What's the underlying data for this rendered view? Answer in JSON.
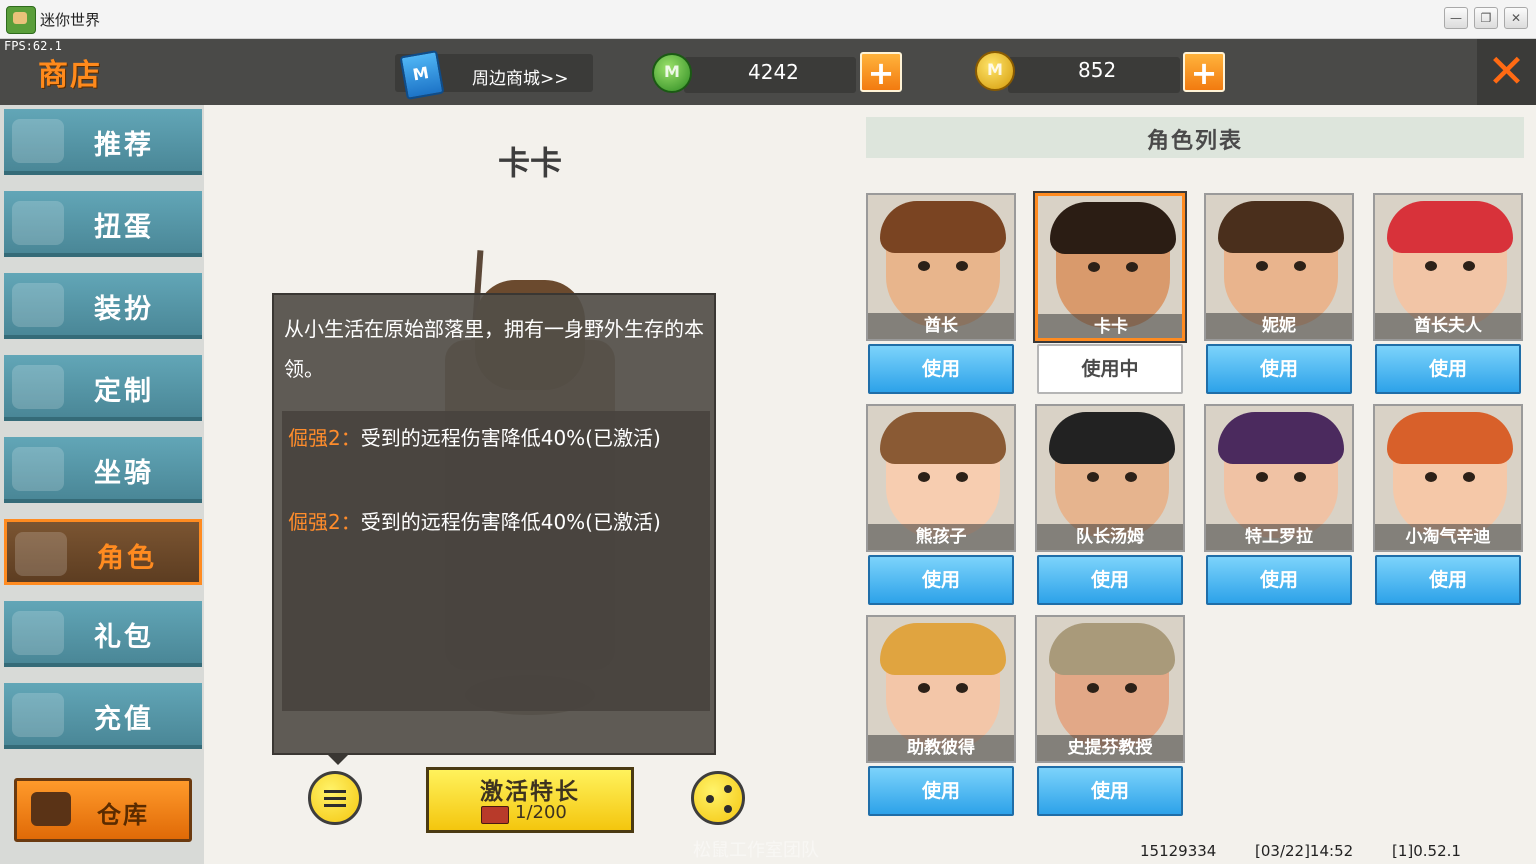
{
  "window": {
    "title": "迷你世界",
    "minimize": "—",
    "maximize": "❐",
    "close": "✕"
  },
  "topbar": {
    "fps": "FPS:62.1",
    "shop_title": "商店",
    "peripheral_link": "周边商城>>",
    "currency_m": "4242",
    "currency_coin": "852",
    "plus": "+",
    "close": "✕"
  },
  "sidebar": {
    "items": [
      {
        "label": "推荐",
        "icon": "thumbs-up-icon"
      },
      {
        "label": "扭蛋",
        "icon": "capsule-icon"
      },
      {
        "label": "装扮",
        "icon": "shirt-icon"
      },
      {
        "label": "定制",
        "icon": "pencil-icon"
      },
      {
        "label": "坐骑",
        "icon": "mount-icon"
      },
      {
        "label": "角色",
        "icon": "character-icon",
        "active": true
      },
      {
        "label": "礼包",
        "icon": "gift-icon"
      },
      {
        "label": "充值",
        "icon": "coins-icon"
      }
    ],
    "warehouse": "仓库"
  },
  "character": {
    "name": "卡卡",
    "description": "从小生活在原始部落里，拥有一身野外生存的本领。",
    "skills": [
      {
        "tag": "倔强2：",
        "text": "受到的远程伤害降低40%(已激活)"
      },
      {
        "tag": "倔强2：",
        "text": "受到的远程伤害降低40%(已激活)"
      }
    ],
    "activate_label": "激活特长",
    "activate_count": "1/200",
    "watermark": "松鼠工作室团队"
  },
  "role_list": {
    "title": "角色列表",
    "characters": [
      {
        "name": "酋长",
        "button": "使用",
        "skin": "#e8b58c",
        "hair": "#7a4422"
      },
      {
        "name": "卡卡",
        "button": "使用中",
        "selected": true,
        "skin": "#d99a6c",
        "hair": "#2b1d14"
      },
      {
        "name": "妮妮",
        "button": "使用",
        "skin": "#e9b48d",
        "hair": "#4a2f1c"
      },
      {
        "name": "酋长夫人",
        "button": "使用",
        "skin": "#f2c5a6",
        "hair": "#d8323a"
      },
      {
        "name": "熊孩子",
        "button": "使用",
        "skin": "#f7cdb0",
        "hair": "#8a5a34"
      },
      {
        "name": "队长汤姆",
        "button": "使用",
        "skin": "#e6b48e",
        "hair": "#222222"
      },
      {
        "name": "特工罗拉",
        "button": "使用",
        "skin": "#f0c2a4",
        "hair": "#4b2a5e"
      },
      {
        "name": "小淘气辛迪",
        "button": "使用",
        "skin": "#f5c8a8",
        "hair": "#d8602a"
      },
      {
        "name": "助教彼得",
        "button": "使用",
        "skin": "#f3c6a8",
        "hair": "#e0a440"
      },
      {
        "name": "史提芬教授",
        "button": "使用",
        "skin": "#e2a887",
        "hair": "#a99a7a"
      }
    ]
  },
  "footer": {
    "uid": "15129334",
    "time": "[03/22]14:52",
    "version": "[1]0.52.1"
  }
}
